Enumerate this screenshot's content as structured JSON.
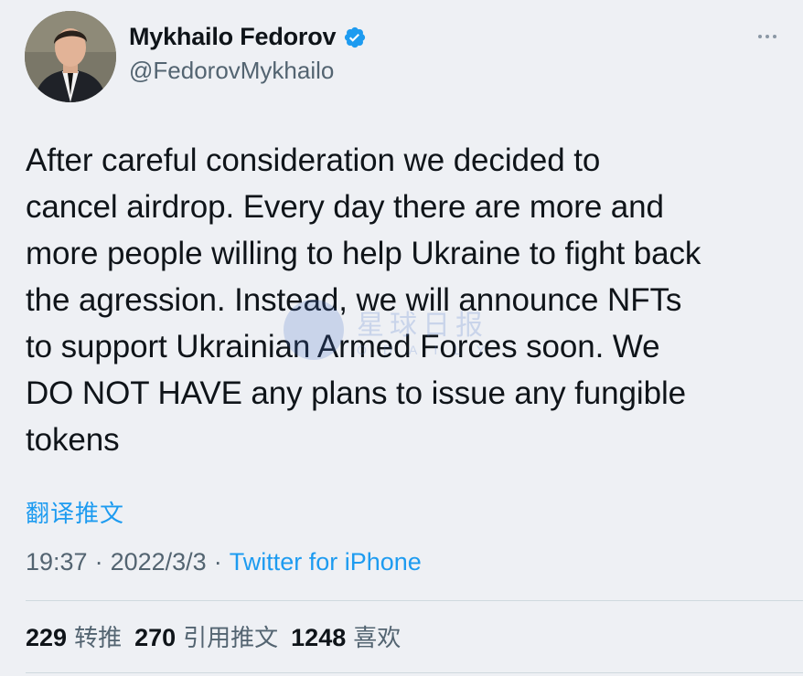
{
  "author": {
    "display_name": "Mykhailo Fedorov",
    "handle": "@FedorovMykhailo",
    "verified": true,
    "avatar_icon": "profile-photo"
  },
  "tweet": {
    "text": "After careful consideration we decided to\ncancel airdrop. Every day there are more and\nmore people willing to help Ukraine to fight back\nthe agression. Instead, we will announce NFTs\nto support Ukrainian Armed Forces soon. We\nDO NOT HAVE any plans to issue any fungible\ntokens",
    "translate_label": "翻译推文",
    "time": "19:37",
    "date": "2022/3/3",
    "separator": "·",
    "source": "Twitter for iPhone"
  },
  "stats": {
    "retweets_count": "229",
    "retweets_label": "转推",
    "quotes_count": "270",
    "quotes_label": "引用推文",
    "likes_count": "1248",
    "likes_label": "喜欢"
  },
  "watermark": {
    "main": "星球日报",
    "sub": "ODAILY"
  },
  "colors": {
    "background": "#eef0f4",
    "link": "#1d9bf0",
    "secondary_text": "#536471",
    "primary_text": "#0f1419",
    "verified_badge": "#1d9bf0"
  },
  "icons": {
    "verified": "verified-badge-icon",
    "more": "more-options-icon"
  }
}
